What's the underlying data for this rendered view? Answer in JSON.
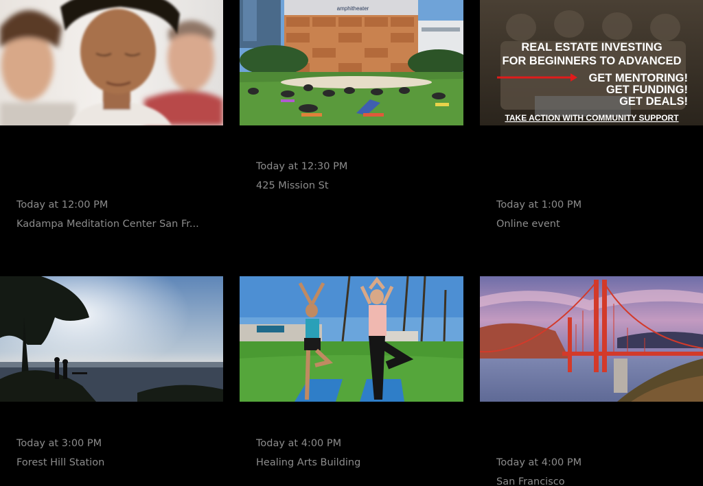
{
  "events": [
    {
      "image_description_name": "meditation-photo",
      "time": "Today at 12:00 PM",
      "location": "Kadampa Meditation Center San Fr..."
    },
    {
      "image_description_name": "amphitheater-yoga-photo",
      "image_sign": "amphitheater",
      "time": "Today at 12:30 PM",
      "location": "425 Mission St"
    },
    {
      "image_description_name": "real-estate-ad-image",
      "ad": {
        "line1": "REAL ESTATE INVESTING",
        "line2": "FOR BEGINNERS TO ADVANCED",
        "line3": "GET MENTORING!",
        "line4": "GET FUNDING!",
        "line5": "GET DEALS!",
        "line6": "TAKE ACTION WITH COMMUNITY SUPPORT"
      },
      "time": "Today at 1:00 PM",
      "location": "Online event"
    },
    {
      "image_description_name": "ocean-overlook-photo",
      "time": "Today at 3:00 PM",
      "location": "Forest Hill Station"
    },
    {
      "image_description_name": "outdoor-yoga-tree-pose-photo",
      "time": "Today at 4:00 PM",
      "location": "Healing Arts Building"
    },
    {
      "image_description_name": "golden-gate-bridge-photo",
      "time": "Today at 4:00 PM",
      "location": "San Francisco"
    }
  ],
  "colors": {
    "background": "#000000",
    "meta_text": "#8c8c8c",
    "ad_arrow": "#e01b1b"
  }
}
